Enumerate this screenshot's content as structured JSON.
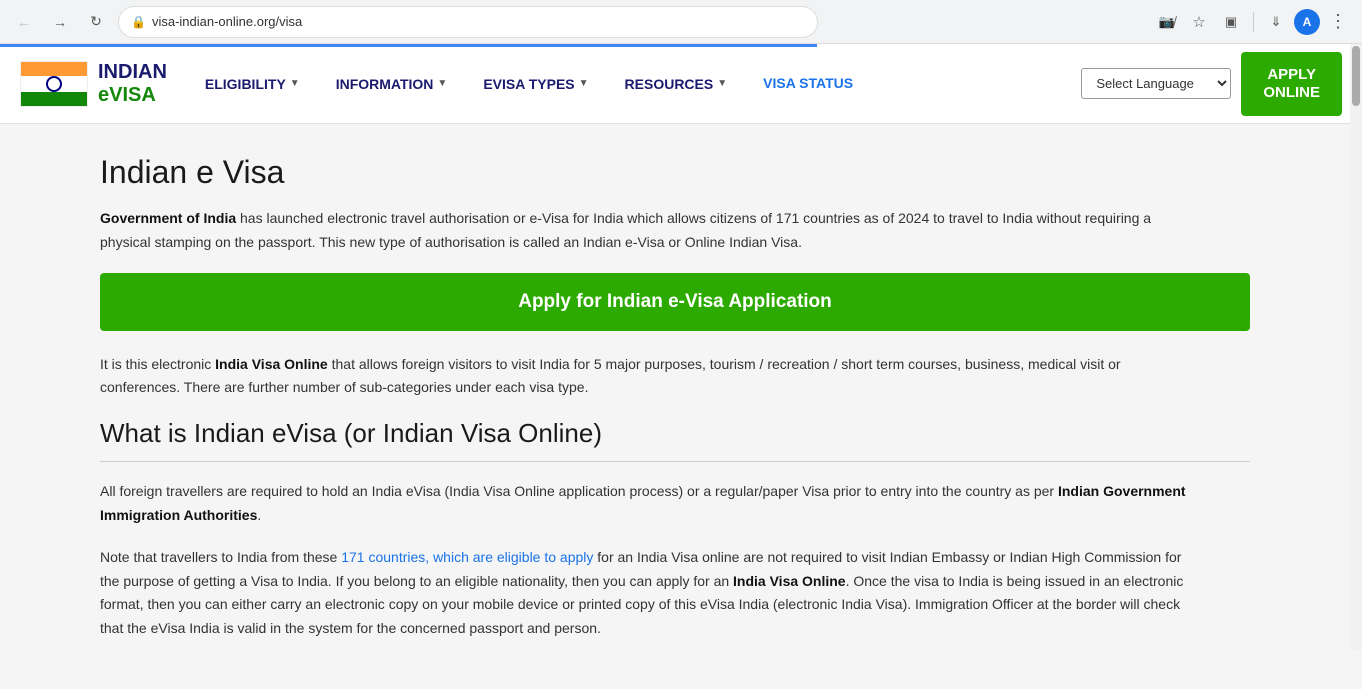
{
  "browser": {
    "url": "visa-indian-online.org/visa",
    "back_disabled": false,
    "forward_disabled": false,
    "avatar_letter": "A"
  },
  "navbar": {
    "logo": {
      "indian": "INDIAN",
      "evisa": "eVISA"
    },
    "menu": [
      {
        "label": "ELIGIBILITY",
        "has_arrow": true
      },
      {
        "label": "INFORMATION",
        "has_arrow": true
      },
      {
        "label": "eVISA TYPES",
        "has_arrow": true
      },
      {
        "label": "RESOURCES",
        "has_arrow": true
      },
      {
        "label": "VISA STATUS",
        "has_arrow": false,
        "is_blue": true
      }
    ],
    "select_language": "Select Language",
    "apply_btn_line1": "APPLY",
    "apply_btn_line2": "ONLINE"
  },
  "content": {
    "main_title": "Indian e Visa",
    "intro_para_1_prefix": "",
    "intro_para_1_bold": "Government of India",
    "intro_para_1_text": " has launched electronic travel authorisation or e-Visa for India which allows citizens of 171 countries as of 2024 to travel to India without requiring a physical stamping on the passport. This new type of authorisation is called an Indian e-Visa or Online Indian Visa.",
    "apply_banner": "Apply for Indian e-Visa Application",
    "purposes_para_prefix": "It is this electronic ",
    "purposes_para_bold": "India Visa Online",
    "purposes_para_text": " that allows foreign visitors to visit India for 5 major purposes, tourism / recreation / short term courses, business, medical visit or conferences. There are further number of sub-categories under each visa type.",
    "section_title": "What is Indian eVisa (or Indian Visa Online)",
    "what_para_1": "All foreign travellers are required to hold an India eVisa (India Visa Online application process) or a regular/paper Visa prior to entry into the country as per ",
    "what_para_1_bold": "Indian Government Immigration Authorities",
    "what_para_1_end": ".",
    "what_para_2_prefix": "Note that travellers to India from these ",
    "what_para_2_link": "171 countries, which are eligible to apply",
    "what_para_2_text": " for an India Visa online are not required to visit Indian Embassy or Indian High Commission for the purpose of getting a Visa to India. If you belong to an eligible nationality, then you can apply for an ",
    "what_para_2_bold": "India Visa Online",
    "what_para_2_text2": ". Once the visa to India is being issued in an electronic format, then you can either carry an electronic copy on your mobile device or printed copy of this eVisa India (electronic India Visa). Immigration Officer at the border will check that the eVisa India is valid in the system for the concerned passport and person."
  }
}
